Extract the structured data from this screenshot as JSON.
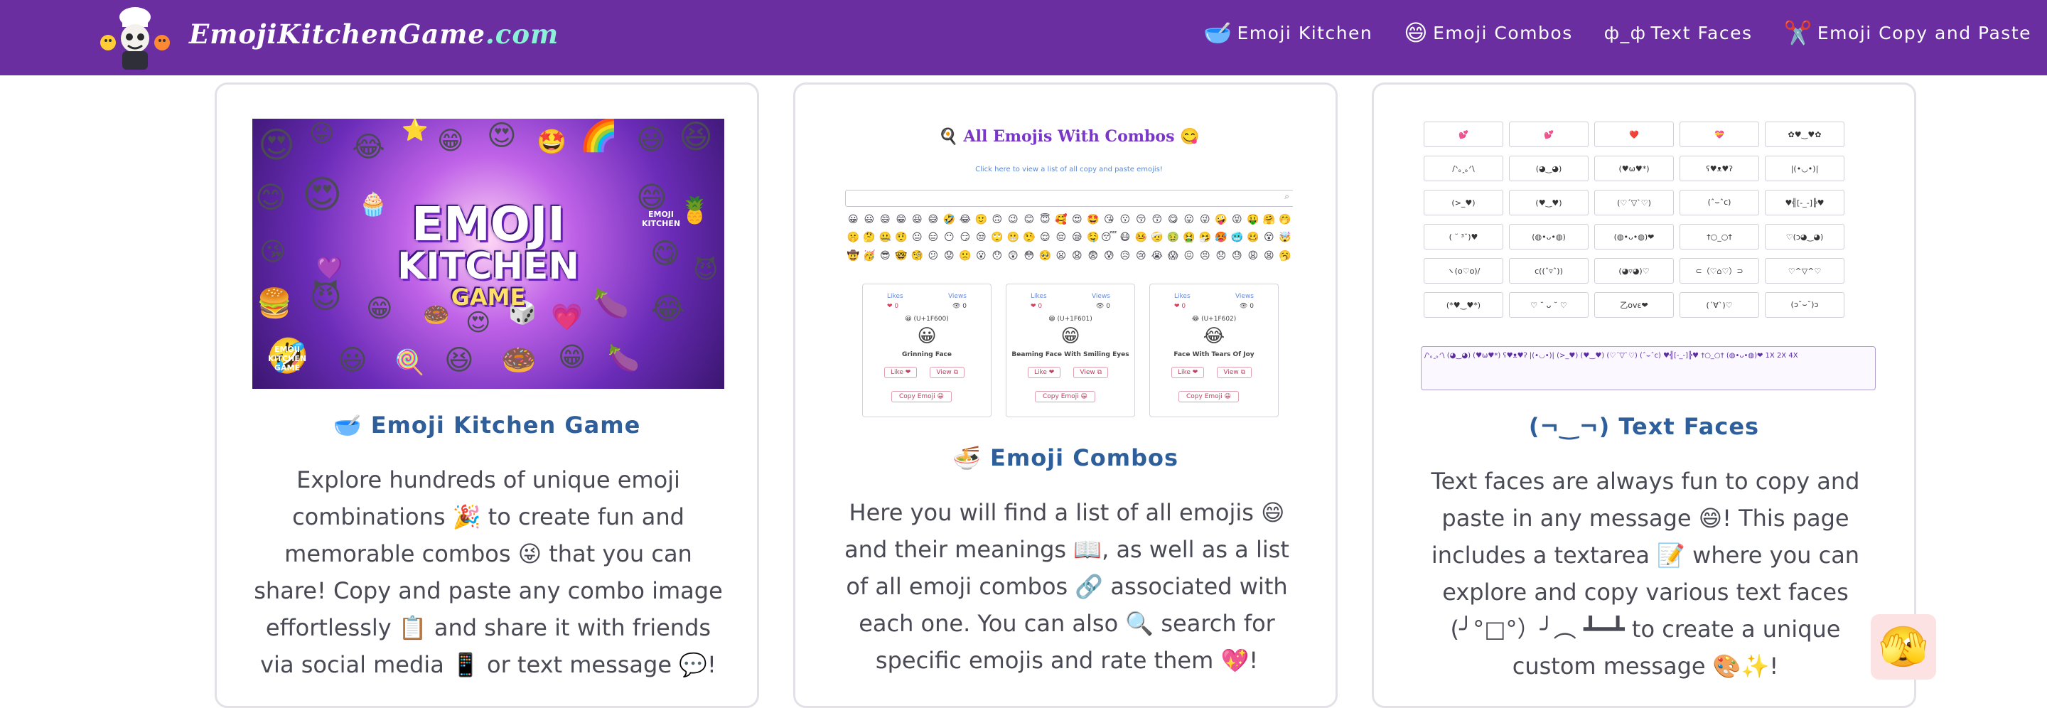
{
  "nav": {
    "brand_name": "EmojiKitchenGame",
    "brand_tld": ".com",
    "links": [
      {
        "icon": "🥣",
        "label": "Emoji Kitchen"
      },
      {
        "icon": "😄",
        "label": "Emoji Combos"
      },
      {
        "icon": "ф_ф",
        "label": "Text Faces"
      },
      {
        "icon": "✂️",
        "label": "Emoji Copy and Paste"
      }
    ]
  },
  "cards": [
    {
      "title": "🥣 Emoji Kitchen Game",
      "description": "Explore hundreds of unique emoji combinations 🎉 to create fun and memorable combos 😜 that you can share! Copy and paste any combo image effortlessly 📋 and share it with friends via social media 📱 or text message 💬!",
      "image": {
        "line1": "EMOJI",
        "line2": "KITCHEN",
        "line3": "GAME",
        "badge1": "EMOJI KITCHEN",
        "badge2": "EMOJI KITCHEN GAME"
      }
    },
    {
      "title": "🍜 Emoji Combos",
      "description": "Here you will find a list of all emojis 😄 and their meanings 📖, as well as a list of all emoji combos 🔗 associated with each one. You can also 🔍 search for specific emojis and rate them 💖!",
      "image": {
        "heading": "🍳 All Emojis With Combos 😋",
        "subheading": "Click here to view a list of all copy and paste emojis!",
        "examples": [
          {
            "code": "😀 (U+1F600)",
            "name": "Grinning Face",
            "emoji": "😀"
          },
          {
            "code": "😁 (U+1F601)",
            "name": "Beaming Face With Smiling Eyes",
            "emoji": "😁"
          },
          {
            "code": "😂 (U+1F602)",
            "name": "Face With Tears Of Joy",
            "emoji": "😂"
          }
        ],
        "like_label": "Like ❤",
        "view_label": "View ⧉",
        "copy_label": "Copy Emoji 😀"
      }
    },
    {
      "title": "(¬‿¬) Text Faces",
      "description": "Text faces are always fun to copy and paste in any message 😄! This page includes a textarea 📝 where you can explore and copy various text faces (╯°□°）╯︵ ┻━┻ to create a unique custom message 🎨✨!",
      "image": {
        "faces": [
          "💕",
          "💕",
          "❤️",
          "💝",
          "✿♥‿♥✿",
          "/ᐠ｡ꞈ｡ᐟ\\",
          "(◕‿◕)",
          "(♥ω♥*)",
          "ʕ♥ᴥ♥ʔ",
          "|(•◡•)|",
          "(>_♥)",
          "(♥‿♥)",
          "(♡´▽`♡)",
          "(ˆ⌣ˆc)",
          "♥╣[-_-]╠♥",
          "( ˘ ³˘)♥",
          "(◍•ᴗ•◍)",
          "(◍•ᴗ•◍)❤",
          "†○_○†",
          "♡(ɔ◕‿◕)",
          "ヽ(o♡o)/",
          "c((ˆ▿ˆ))",
          "(◕▿◕)♡",
          "⊂（♡⌂♡）⊃",
          "♡^▽^♡",
          "(*♥‿♥*)",
          "♡ ˘ ᴗ ˘ ♡",
          "乙ovε❤",
          "(´∀`)♡",
          "(ɔ˘⌣˘)ɔ"
        ],
        "textarea": "/ᐠ｡ꞈ｡ᐟ\\ (◕‿◕) (♥ω♥*) ʕ♥ᴥ♥ʔ |(•◡•)| (>_♥) (♥‿♥) (♡´▽`♡) (ˆ⌣ˆc) ♥╣[-_-]╠♥ †○_○† (◍•ᴗ•◍)❤ 1X 2X 4X"
      }
    }
  ],
  "floating_button_icon": "🫣"
}
